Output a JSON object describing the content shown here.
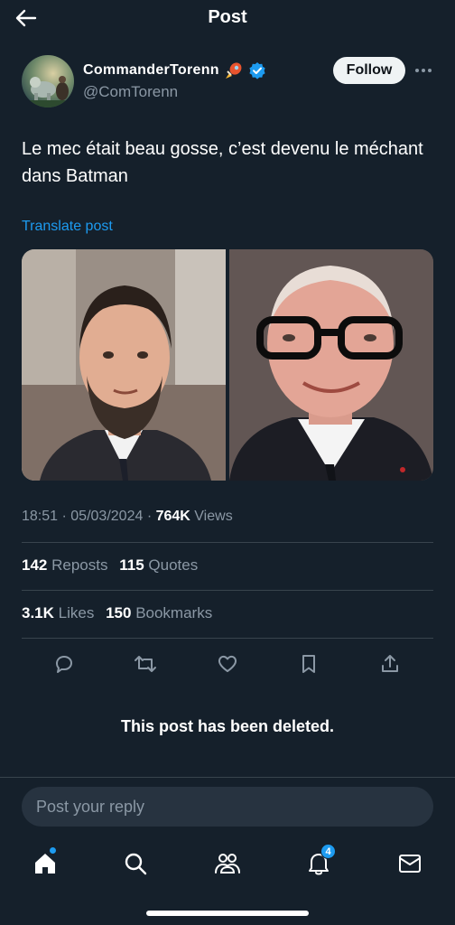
{
  "header": {
    "title": "Post"
  },
  "author": {
    "display_name": "CommanderTorenn",
    "handle": "@ComTorenn",
    "verified": true
  },
  "follow_label": "Follow",
  "post": {
    "text": "Le mec était beau gosse, c’est devenu le méchant dans Batman",
    "translate_label": "Translate post"
  },
  "meta": {
    "time": "18:51",
    "date": "05/03/2024",
    "views_count": "764K",
    "views_label": "Views"
  },
  "stats": {
    "reposts_count": "142",
    "reposts_label": "Reposts",
    "quotes_count": "115",
    "quotes_label": "Quotes",
    "likes_count": "3.1K",
    "likes_label": "Likes",
    "bookmarks_count": "150",
    "bookmarks_label": "Bookmarks"
  },
  "deleted_notice": "This post has been deleted.",
  "reply": {
    "placeholder": "Post your reply"
  },
  "tabbar": {
    "notifications_badge": "4"
  },
  "colors": {
    "background": "#15202b",
    "accent": "#1d9bf0",
    "muted_text": "#8b98a5",
    "divider": "#38444d"
  },
  "icons": [
    "back-arrow-icon",
    "verified-badge-icon",
    "rocket-emoji-icon",
    "more-icon",
    "reply-icon",
    "repost-icon",
    "like-icon",
    "bookmark-icon",
    "share-icon",
    "home-icon",
    "search-icon",
    "communities-icon",
    "notifications-icon",
    "messages-icon"
  ]
}
